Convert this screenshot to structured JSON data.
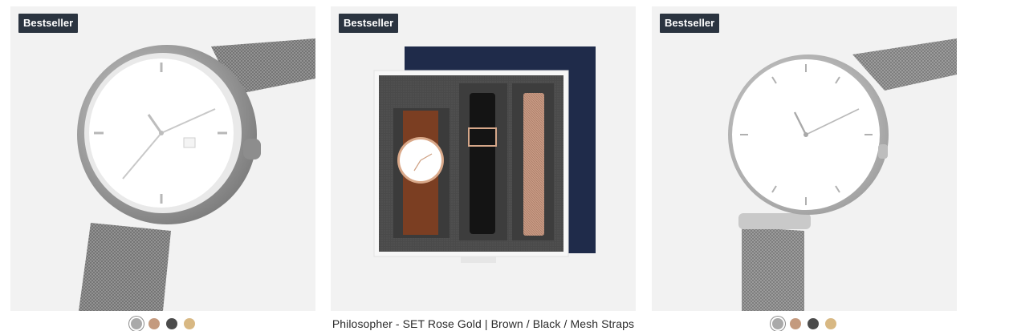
{
  "products": [
    {
      "badge": "Bestseller",
      "image_icon": "watch-silver-mesh",
      "swatches": [
        {
          "name": "silver",
          "color": "#a9a9a9",
          "selected": true
        },
        {
          "name": "rose-gold",
          "color": "#c49a7e",
          "selected": false
        },
        {
          "name": "dark-gunmetal",
          "color": "#4b4b4b",
          "selected": false
        },
        {
          "name": "gold",
          "color": "#d8b883",
          "selected": false
        }
      ]
    },
    {
      "badge": "Bestseller",
      "image_icon": "gift-set-box",
      "title": "Philosopher - SET Rose Gold | Brown / Black / Mesh Straps"
    },
    {
      "badge": "Bestseller",
      "image_icon": "watch-silver-mesh-thin",
      "swatches": [
        {
          "name": "silver",
          "color": "#a9a9a9",
          "selected": true
        },
        {
          "name": "rose-gold",
          "color": "#c49a7e",
          "selected": false
        },
        {
          "name": "dark-gunmetal",
          "color": "#4b4b4b",
          "selected": false
        },
        {
          "name": "gold",
          "color": "#d8b883",
          "selected": false
        }
      ]
    }
  ],
  "colors": {
    "badge_bg": "#2b3440",
    "photo_bg": "#f2f2f2"
  }
}
